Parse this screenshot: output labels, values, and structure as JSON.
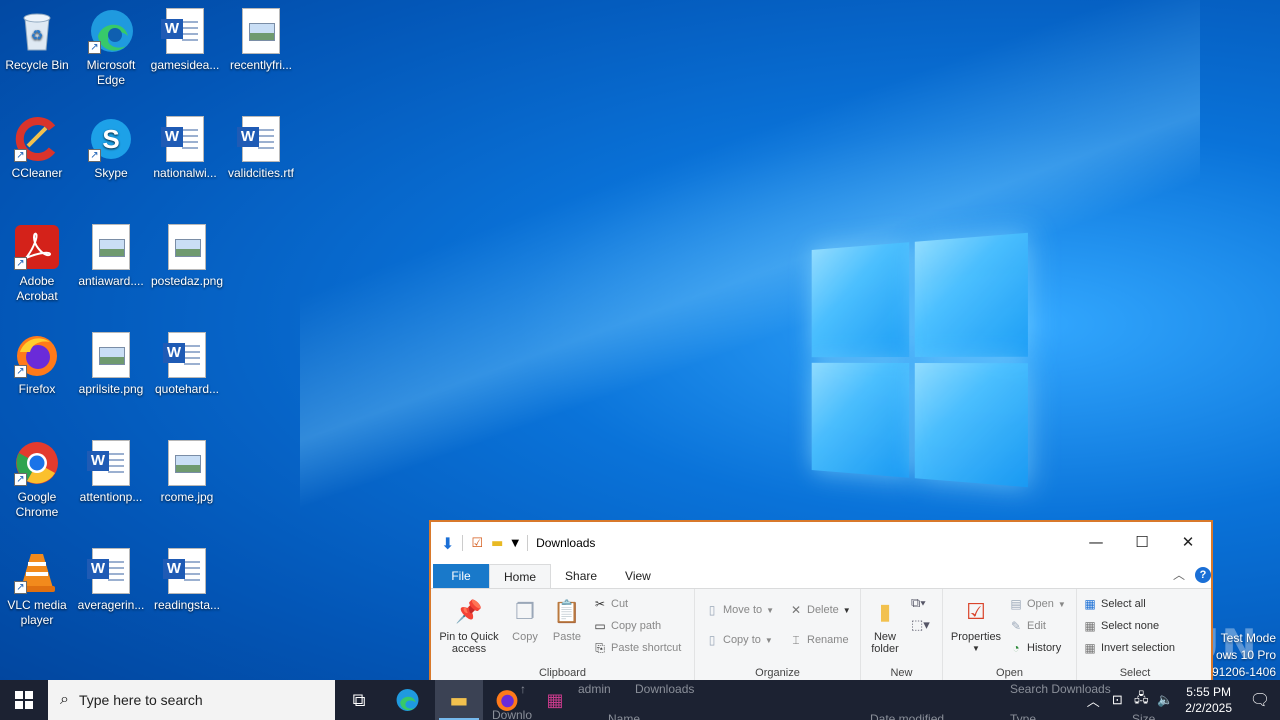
{
  "desktop": {
    "icons": [
      {
        "label": "Recycle Bin",
        "icon": "recycle-bin-icon"
      },
      {
        "label": "Microsoft Edge",
        "icon": "edge-icon"
      },
      {
        "label": "gamesidea...",
        "icon": "word-doc-icon"
      },
      {
        "label": "recentlyfri...",
        "icon": "image-file-icon"
      },
      {
        "label": "CCleaner",
        "icon": "ccleaner-icon"
      },
      {
        "label": "Skype",
        "icon": "skype-icon"
      },
      {
        "label": "nationalwi...",
        "icon": "word-doc-icon"
      },
      {
        "label": "validcities.rtf",
        "icon": "word-doc-icon"
      },
      {
        "label": "Adobe Acrobat",
        "icon": "acrobat-icon"
      },
      {
        "label": "antiaward....",
        "icon": "image-file-icon"
      },
      {
        "label": "postedaz.png",
        "icon": "image-file-icon"
      },
      {
        "label": "Firefox",
        "icon": "firefox-icon"
      },
      {
        "label": "aprilsite.png",
        "icon": "image-file-icon"
      },
      {
        "label": "quotehard...",
        "icon": "word-doc-icon"
      },
      {
        "label": "Google Chrome",
        "icon": "chrome-icon"
      },
      {
        "label": "attentionp...",
        "icon": "word-doc-icon"
      },
      {
        "label": "rcome.jpg",
        "icon": "image-file-icon"
      },
      {
        "label": "VLC media player",
        "icon": "vlc-icon"
      },
      {
        "label": "averagerin...",
        "icon": "word-doc-icon"
      },
      {
        "label": "readingsta...",
        "icon": "word-doc-icon"
      }
    ]
  },
  "explorer": {
    "title": "Downloads",
    "tabs": [
      "File",
      "Home",
      "Share",
      "View"
    ],
    "ribbon": {
      "clipboard": {
        "pin": "Pin to Quick access",
        "copy": "Copy",
        "paste": "Paste",
        "cut": "Cut",
        "copy_path": "Copy path",
        "paste_shortcut": "Paste shortcut",
        "label": "Clipboard"
      },
      "organize": {
        "move_to": "Move to",
        "copy_to": "Copy to",
        "delete": "Delete",
        "rename": "Rename",
        "label": "Organize"
      },
      "new": {
        "new_folder": "New folder",
        "label": "New"
      },
      "open": {
        "properties": "Properties",
        "open": "Open",
        "edit": "Edit",
        "history": "History",
        "label": "Open"
      },
      "select": {
        "select_all": "Select all",
        "select_none": "Select none",
        "invert": "Invert selection",
        "label": "Select"
      }
    },
    "address": {
      "path1": "admin",
      "path2": "Downloads",
      "search_placeholder": "Search Downloads"
    },
    "columns": {
      "name": "Name",
      "date": "Date modified",
      "type": "Type",
      "size": "Size"
    },
    "nav_item": "Downlo"
  },
  "taskbar": {
    "search_placeholder": "Type here to search",
    "time": "5:55 PM",
    "date": "2/2/2025"
  },
  "sysinfo": {
    "line1": "Test Mode",
    "line2": "ows 10 Pro",
    "line3": "91206-1406"
  },
  "watermark": "ANY.RUN"
}
